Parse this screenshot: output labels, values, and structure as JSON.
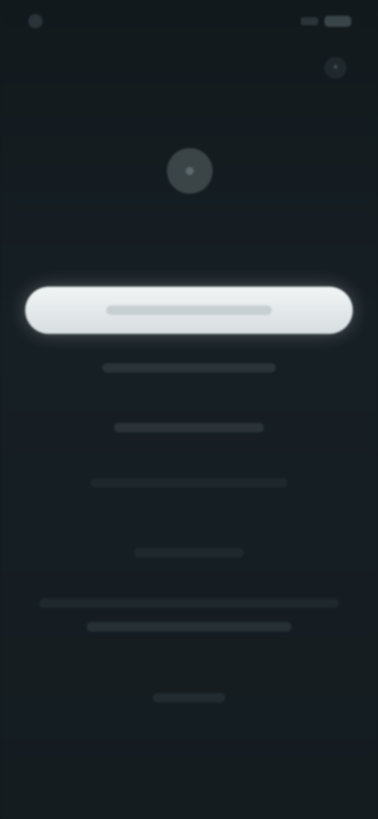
{
  "status_bar": {
    "time": ""
  },
  "header": {
    "title": "",
    "subtitle": ""
  },
  "logo": {
    "icon": "logo-icon"
  },
  "main": {
    "title": "",
    "primary_button_label": "",
    "link_1": "",
    "link_2": "",
    "link_3": "",
    "section_label": "",
    "legal_text": "",
    "footer_link": ""
  },
  "colors": {
    "background": "#121a1e",
    "primary_button": "#e6ecee",
    "muted_text": "#58656b"
  }
}
